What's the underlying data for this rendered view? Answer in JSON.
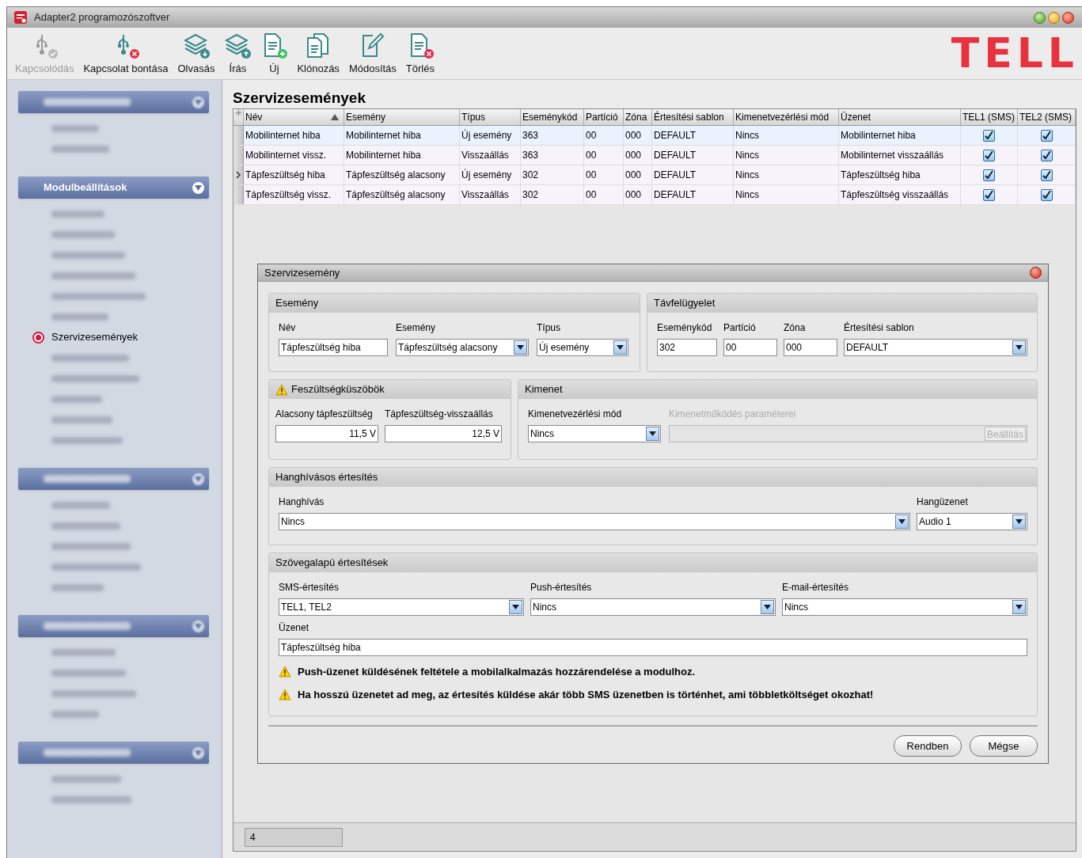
{
  "window": {
    "title": "Adapter2 programozószoftver"
  },
  "toolbar": [
    {
      "kind": "usb-ok",
      "label": "Kapcsolódás",
      "disabled": true
    },
    {
      "kind": "usb-x",
      "label": "Kapcsolat bontása",
      "disabled": false
    },
    {
      "kind": "layers-down",
      "label": "Olvasás",
      "disabled": false
    },
    {
      "kind": "layers-up",
      "label": "Írás",
      "disabled": false
    },
    {
      "kind": "doc-plus",
      "label": "Új",
      "disabled": false
    },
    {
      "kind": "doc-copy",
      "label": "Klónozás",
      "disabled": false
    },
    {
      "kind": "doc-edit",
      "label": "Módosítás",
      "disabled": false
    },
    {
      "kind": "doc-x",
      "label": "Törlés",
      "disabled": false
    }
  ],
  "logo": "TELL",
  "sidebar": {
    "sections": [
      {
        "blurred": true,
        "items": [
          {
            "blurred": true,
            "selected": false
          },
          {
            "blurred": true,
            "selected": false
          }
        ]
      },
      {
        "blurred": false,
        "title": "Modulbeállítások",
        "items": [
          {
            "blurred": true,
            "selected": false
          },
          {
            "blurred": true,
            "selected": false
          },
          {
            "blurred": true,
            "selected": false
          },
          {
            "blurred": true,
            "selected": false
          },
          {
            "blurred": true,
            "selected": false
          },
          {
            "blurred": true,
            "selected": false
          },
          {
            "blurred": false,
            "label": "Szervizesemények",
            "selected": true
          },
          {
            "blurred": true,
            "selected": false
          },
          {
            "blurred": true,
            "selected": false
          },
          {
            "blurred": true,
            "selected": false
          },
          {
            "blurred": true,
            "selected": false
          },
          {
            "blurred": true,
            "selected": false
          }
        ]
      },
      {
        "blurred": true,
        "items": [
          {
            "blurred": true,
            "selected": false
          },
          {
            "blurred": true,
            "selected": false
          },
          {
            "blurred": true,
            "selected": false
          },
          {
            "blurred": true,
            "selected": false
          },
          {
            "blurred": true,
            "selected": false
          }
        ]
      },
      {
        "blurred": true,
        "items": [
          {
            "blurred": true,
            "selected": false
          },
          {
            "blurred": true,
            "selected": false
          },
          {
            "blurred": true,
            "selected": false
          },
          {
            "blurred": true,
            "selected": false
          }
        ]
      },
      {
        "blurred": true,
        "items": [
          {
            "blurred": true,
            "selected": false
          },
          {
            "blurred": true,
            "selected": false
          }
        ]
      }
    ]
  },
  "page_title": "Szervizesemények",
  "table": {
    "columns": [
      "Név",
      "Esemény",
      "Típus",
      "Eseménykód",
      "Partíció",
      "Zóna",
      "Értesítési sablon",
      "Kimenetvezérlési mód",
      "Üzenet",
      "TEL1 (SMS)",
      "TEL2 (SMS)"
    ],
    "rows": [
      {
        "selected": true,
        "current": false,
        "cells": [
          "Mobilinternet hiba",
          "Mobilinternet hiba",
          "Új esemény",
          "363",
          "00",
          "000",
          "DEFAULT",
          "Nincs",
          "Mobilinternet hiba"
        ],
        "tel1": true,
        "tel2": true
      },
      {
        "selected": false,
        "current": false,
        "cells": [
          "Mobilinternet vissz.",
          "Mobilinternet hiba",
          "Visszaállás",
          "363",
          "00",
          "000",
          "DEFAULT",
          "Nincs",
          "Mobilinternet visszaállás"
        ],
        "tel1": true,
        "tel2": true
      },
      {
        "selected": false,
        "current": true,
        "cells": [
          "Tápfeszültség hiba",
          "Tápfeszültség alacsony",
          "Új esemény",
          "302",
          "00",
          "000",
          "DEFAULT",
          "Nincs",
          "Tápfeszültség hiba"
        ],
        "tel1": true,
        "tel2": true
      },
      {
        "selected": false,
        "current": false,
        "cells": [
          "Tápfeszültség vissz.",
          "Tápfeszültség alacsony",
          "Visszaállás",
          "302",
          "00",
          "000",
          "DEFAULT",
          "Nincs",
          "Tápfeszültség visszaállás"
        ],
        "tel1": true,
        "tel2": true
      }
    ]
  },
  "dialog": {
    "title": "Szervizesemény",
    "groups": [
      {
        "title": "Esemény",
        "warning": false,
        "fields": [
          {
            "label": "Név",
            "value": "Tápfeszültség hiba",
            "kind": "text"
          },
          {
            "label": "Esemény",
            "value": "Tápfeszültség alacsony",
            "kind": "select"
          },
          {
            "label": "Típus",
            "value": "Új esemény",
            "kind": "select"
          }
        ]
      },
      {
        "title": "Távfelügyelet",
        "warning": false,
        "fields": [
          {
            "label": "Eseménykód",
            "value": "302",
            "kind": "text"
          },
          {
            "label": "Partíció",
            "value": "00",
            "kind": "text"
          },
          {
            "label": "Zóna",
            "value": "000",
            "kind": "text"
          },
          {
            "label": "Értesítési sablon",
            "value": "DEFAULT",
            "kind": "select"
          }
        ]
      },
      {
        "title": "Feszültségküszöbök",
        "warning": true,
        "fields": [
          {
            "label": "Alacsony tápfeszültség",
            "value": "11,5 V",
            "kind": "number"
          },
          {
            "label": "Tápfeszültség-visszaállás",
            "value": "12,5 V",
            "kind": "number"
          }
        ]
      },
      {
        "title": "Kimenet",
        "warning": false,
        "fields": [
          {
            "label": "Kimenetvezérlési mód",
            "value": "Nincs",
            "kind": "select"
          },
          {
            "label": "Kimenetműködés paraméterei",
            "button": "Beállítás",
            "kind": "disabled"
          }
        ]
      },
      {
        "title": "Hanghívásos értesítés",
        "warning": false,
        "fields": [
          {
            "label": "Hanghívás",
            "value": "Nincs",
            "kind": "select"
          },
          {
            "label": "Hangüzenet",
            "value": "Audio 1",
            "kind": "select"
          }
        ]
      },
      {
        "title": "Szövegalapú értesítések",
        "warning": false,
        "fields": [
          {
            "label": "SMS-értesítés",
            "value": "TEL1, TEL2",
            "kind": "select"
          },
          {
            "label": "Push-értesítés",
            "value": "Nincs",
            "kind": "select"
          },
          {
            "label": "E-mail-értesítés",
            "value": "Nincs",
            "kind": "select"
          },
          {
            "label": "Üzenet",
            "value": "Tápfeszültség hiba",
            "kind": "text"
          }
        ],
        "notes": [
          "Push-üzenet küldésének feltétele a mobilalkalmazás hozzárendelése a modulhoz.",
          "Ha hosszú üzenetet ad meg, az értesítés küldése akár több SMS üzenetben is történhet, ami többletköltséget okozhat!"
        ]
      }
    ],
    "buttons": [
      "Rendben",
      "Mégse"
    ]
  },
  "status_bar": {
    "count": "4"
  }
}
